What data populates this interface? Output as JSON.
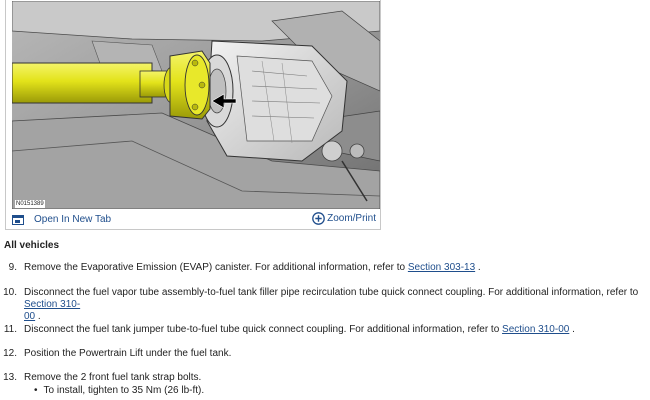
{
  "figure": {
    "id_label": "N0151389",
    "open_tab_label": "Open In New Tab",
    "zoom_label": "Zoom/Print",
    "icons": {
      "open_tab": "window-icon",
      "zoom": "zoom-plus-icon"
    },
    "colors": {
      "shaft": "#e3e31a",
      "background": "#8f8f8f",
      "link": "#1f4e8c"
    }
  },
  "section": {
    "heading": "All vehicles"
  },
  "steps": [
    {
      "num": "9.",
      "text": "Remove the Evaporative Emission (EVAP) canister. For additional information, refer to ",
      "link": "Section 303-13",
      "after": " ."
    },
    {
      "num": "10.",
      "text": "Disconnect the fuel vapor tube assembly-to-fuel tank filler pipe recirculation tube quick connect coupling. For additional information, refer to ",
      "link": "Section  310-",
      "link2": "00",
      "after": " ."
    },
    {
      "num": "11.",
      "text": "Disconnect the fuel tank jumper tube-to-fuel tube quick connect coupling. For additional information, refer to ",
      "link": "Section  310-00",
      "after": " ."
    },
    {
      "num": "12.",
      "text": "Position the Powertrain Lift under the fuel tank."
    },
    {
      "num": "13.",
      "text": "Remove the 2 front fuel tank strap bolts.",
      "sub": "To install, tighten to 35 Nm (26 lb-ft)."
    }
  ]
}
